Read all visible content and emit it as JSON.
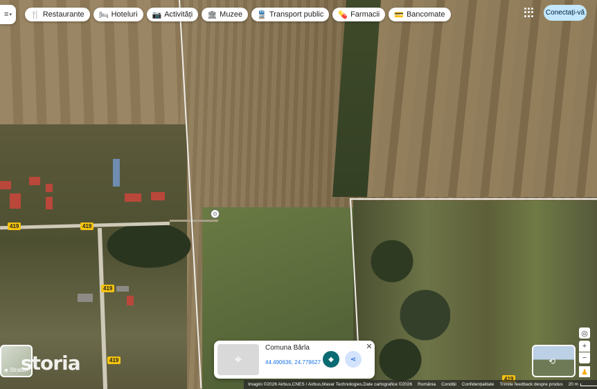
{
  "chips": [
    {
      "icon": "restaurant-icon",
      "glyph": "🍴",
      "label": "Restaurante"
    },
    {
      "icon": "hotel-icon",
      "glyph": "🛏",
      "label": "Hoteluri"
    },
    {
      "icon": "camera-icon",
      "glyph": "📷",
      "label": "Activități"
    },
    {
      "icon": "museum-icon",
      "glyph": "🏛",
      "label": "Muzee"
    },
    {
      "icon": "transit-icon",
      "glyph": "🚆",
      "label": "Transport public"
    },
    {
      "icon": "pharmacy-icon",
      "glyph": "💊",
      "label": "Farmacii"
    },
    {
      "icon": "atm-icon",
      "glyph": "💳",
      "label": "Bancomate"
    }
  ],
  "header": {
    "sign_in": "Conectați-vă"
  },
  "road_labels": [
    "419",
    "419",
    "419",
    "419",
    "419"
  ],
  "layers": {
    "label": "Straturi"
  },
  "watermark": "storia",
  "card": {
    "title": "Comuna Bârla",
    "coords": "44.490636, 24.778627"
  },
  "footer": {
    "imagery": "Imagini ©2026 Airbus,CNES / Airbus,Maxar Technologies,Date cartografice ©2026",
    "country": "România",
    "terms": "Condiții",
    "privacy": "Confidențialitate",
    "feedback": "Trimite feedback despre produs",
    "scale": "20 m"
  }
}
